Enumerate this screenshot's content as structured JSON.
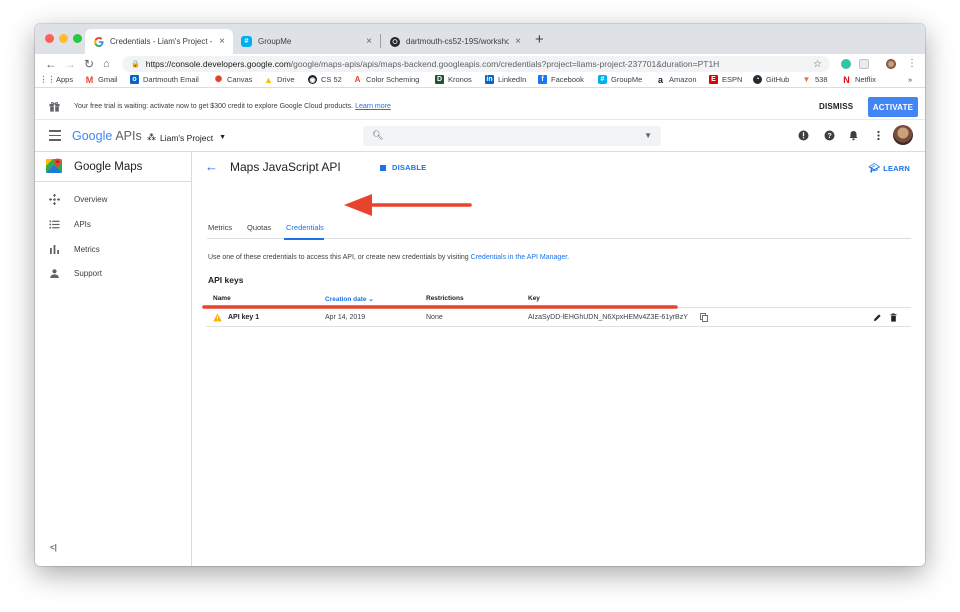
{
  "browser": {
    "tabs": [
      {
        "title": "Credentials - Liam's Project - G",
        "favicon": "google-g-icon",
        "active": true
      },
      {
        "title": "GroupMe",
        "favicon": "groupme-icon",
        "active": false
      },
      {
        "title": "dartmouth-cs52-19S/workshop",
        "favicon": "github-icon",
        "active": false
      }
    ],
    "url_host": "https://console.developers.google.com",
    "url_rest": "/google/maps-apis/apis/maps-backend.googleapis.com/credentials?project=liams-project-237701&duration=PT1H",
    "bookmarks": [
      "Apps",
      "Gmail",
      "Dartmouth Email",
      "Canvas",
      "Drive",
      "CS 52",
      "Color Scheming",
      "Kronos",
      "LinkedIn",
      "Facebook",
      "GroupMe",
      "Amazon",
      "ESPN",
      "GitHub",
      "538",
      "Netflix"
    ],
    "bookmarks_overflow": "»"
  },
  "banner": {
    "message": "Your free trial is waiting: activate now to get $300 credit to explore Google Cloud products.",
    "learn_more": "Learn more",
    "dismiss": "DISMISS",
    "activate": "ACTIVATE"
  },
  "header": {
    "logo_google": "Google",
    "logo_apis": "APIs",
    "project": "Liam's Project"
  },
  "sidebar": {
    "title": "Google Maps",
    "items": [
      {
        "label": "Overview",
        "icon": "overview-icon"
      },
      {
        "label": "APIs",
        "icon": "list-icon"
      },
      {
        "label": "Metrics",
        "icon": "bar-chart-icon"
      },
      {
        "label": "Support",
        "icon": "person-icon"
      }
    ],
    "collapse": "<|"
  },
  "main": {
    "title": "Maps JavaScript API",
    "disable": "DISABLE",
    "learn": "LEARN",
    "tabs": [
      "Metrics",
      "Quotas",
      "Credentials"
    ],
    "selected_tab": "Credentials",
    "description_prefix": "Use one of these credentials to access this API, or create new credentials by visiting",
    "description_link": "Credentials in the API Manager",
    "description_suffix": ".",
    "section": "API keys",
    "columns": [
      "Name",
      "Creation date",
      "Restrictions",
      "Key"
    ],
    "sort_indicator": "⌄",
    "rows": [
      {
        "name": "API key 1",
        "date": "Apr 14, 2019",
        "restrictions": "None",
        "key": "AIzaSyDD-lEHGhUDN_N6XpxHEMv4Z3E-61yrBzY"
      }
    ]
  },
  "colors": {
    "accent": "#1a73e8",
    "activate": "#4285f4",
    "annotation": "#e8432d",
    "warning": "#f9ab00"
  }
}
